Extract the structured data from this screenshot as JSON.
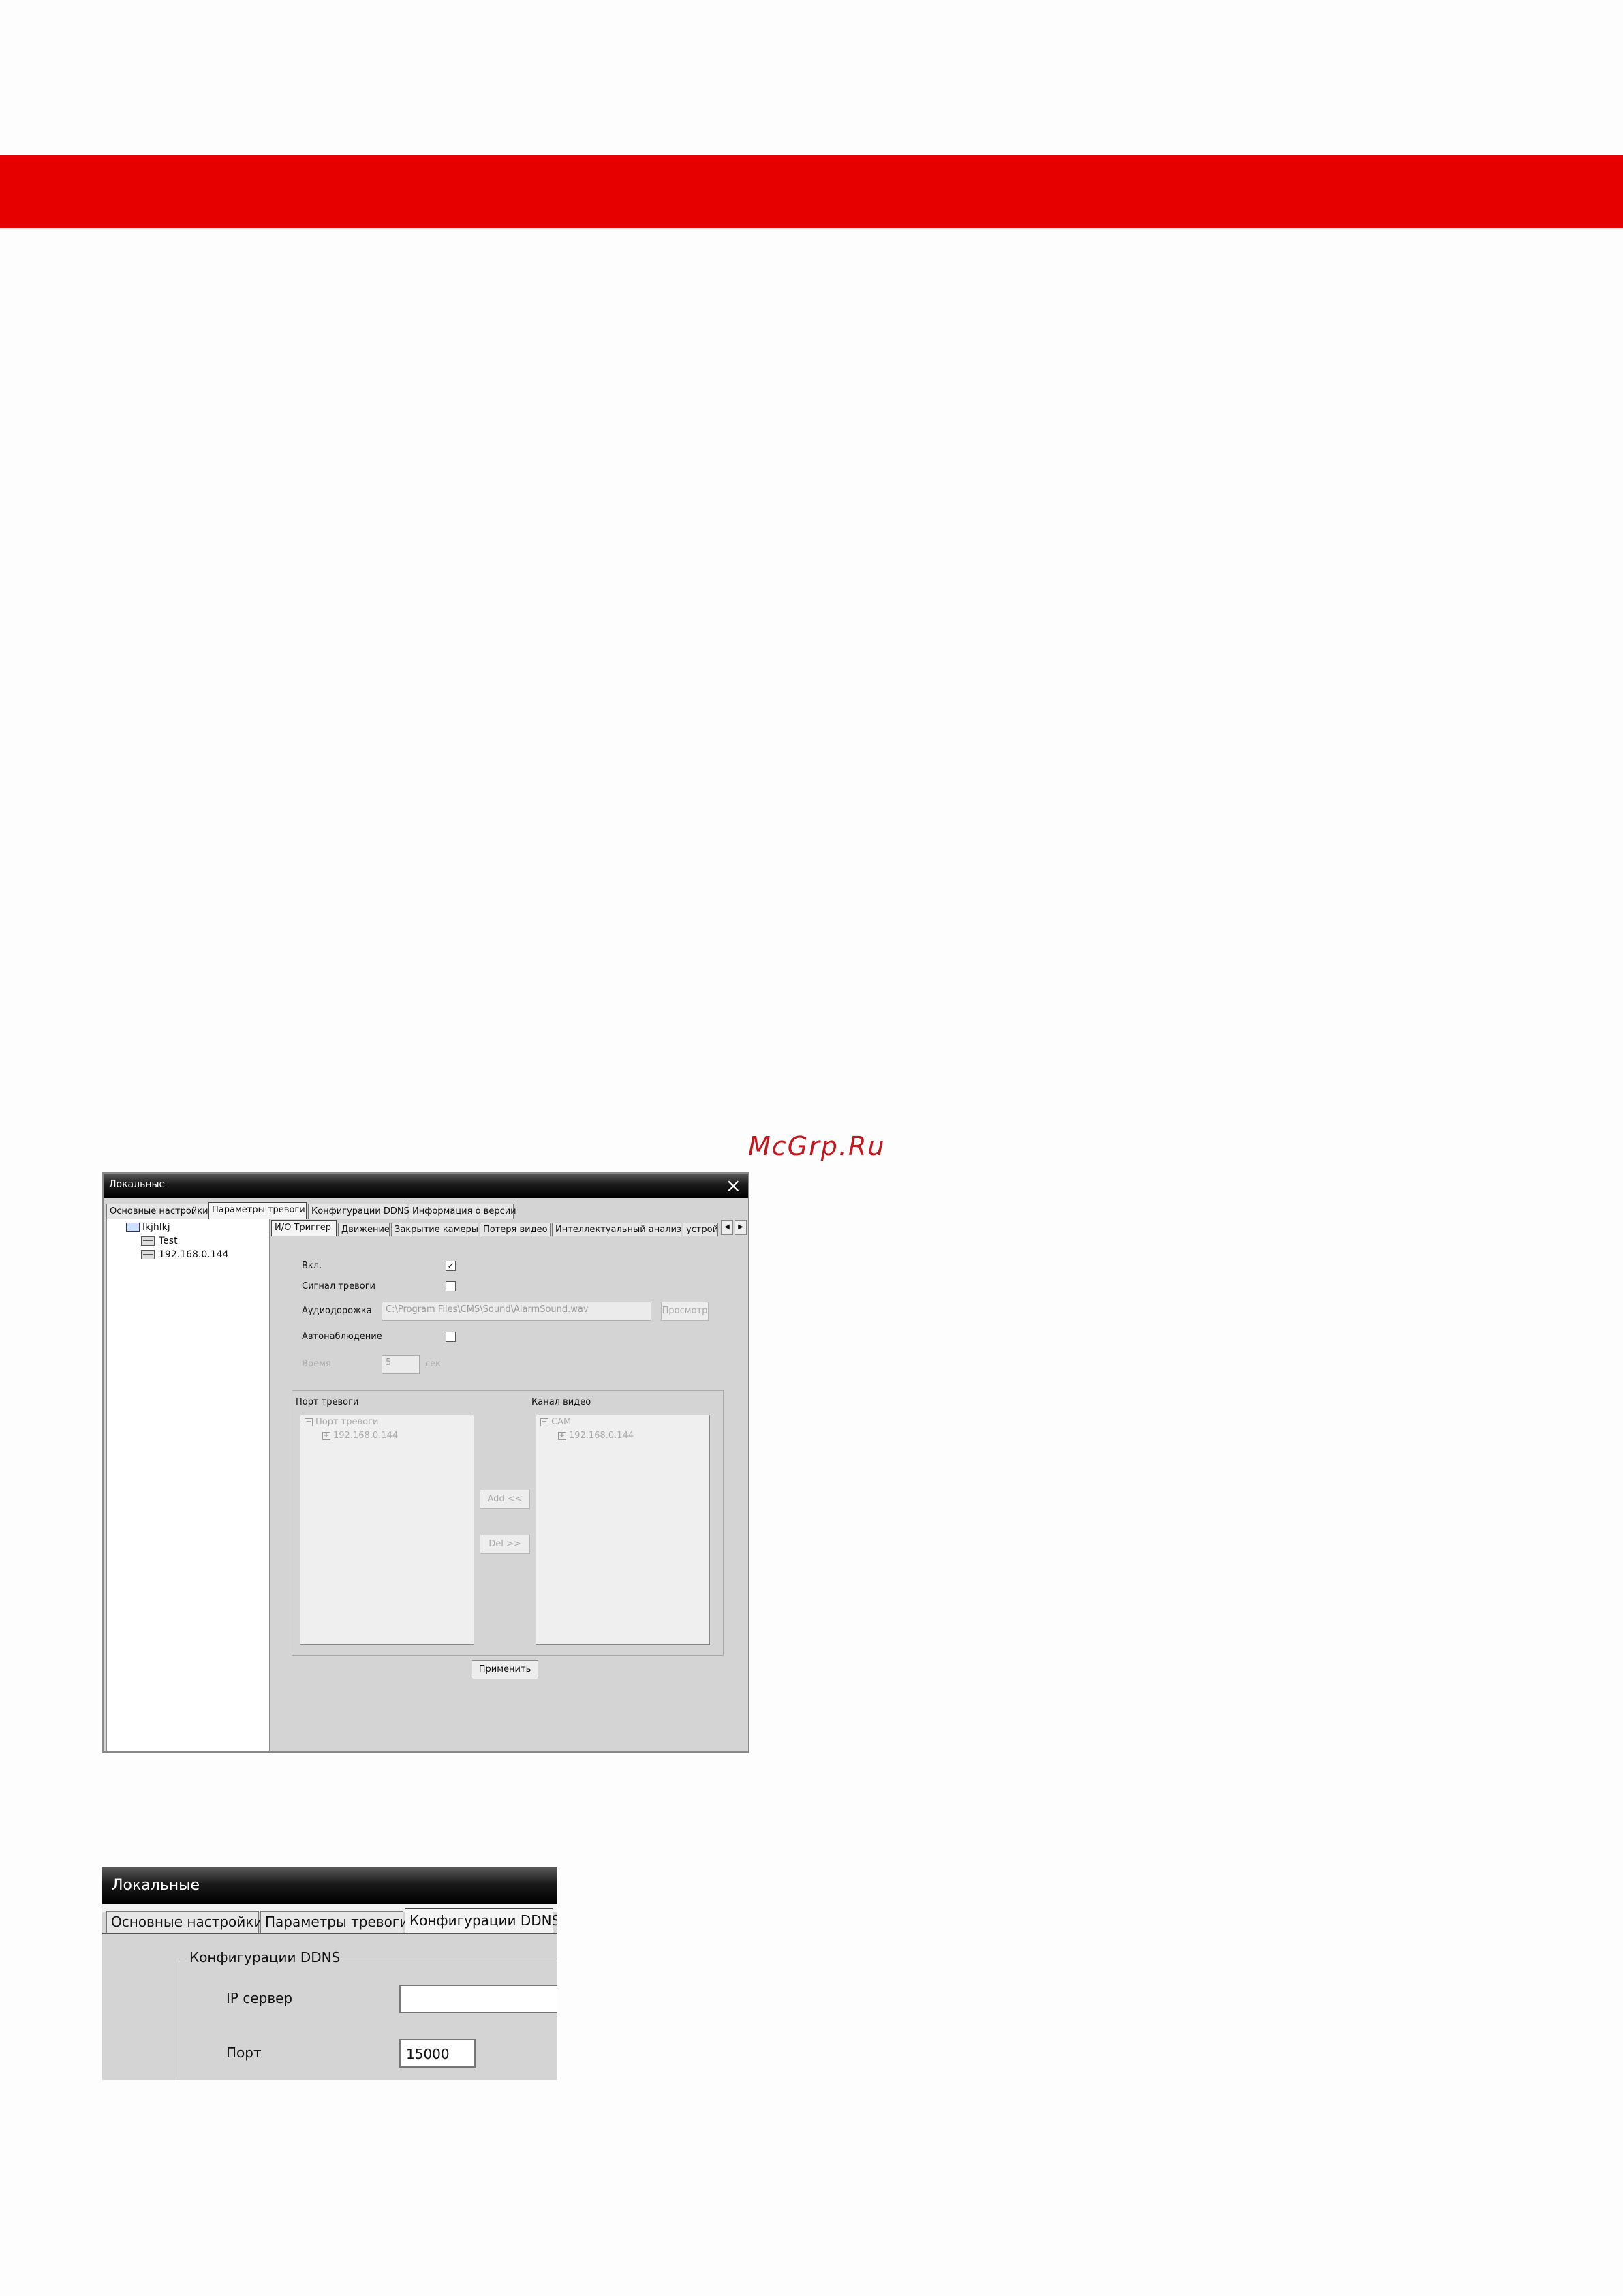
{
  "colors": {
    "banner": "#e60000",
    "watermark": "#c4161c"
  },
  "watermark": "McGrp.Ru",
  "window1": {
    "title": "Локальные",
    "main_tabs": [
      "Основные настройки",
      "Параметры тревоги",
      "Конфигурации DDNS",
      "Информация о версии"
    ],
    "tree": {
      "root": "lkjhlkj",
      "children": [
        "Test",
        "192.168.0.144"
      ]
    },
    "sub_tabs": [
      "И/О Триггер",
      "Движение",
      "Закрытие камеры",
      "Потеря видео",
      "Интеллектуальный анализ",
      "устрой"
    ],
    "enable_label": "Вкл.",
    "alarm_signal_label": "Сигнал тревоги",
    "audio_label": "Аудиодорожка",
    "audio_path": "C:\\Program Files\\CMS\\Sound\\AlarmSound.wav",
    "browse_label": "Просмотр",
    "auto_monitor_label": "Автонаблюдение",
    "time_label": "Время",
    "time_value": "5",
    "time_unit": "сек",
    "alarm_port_title": "Порт тревоги",
    "alarm_port_tree": {
      "root": "Порт тревоги",
      "child": "192.168.0.144"
    },
    "video_channel_title": "Канал видео",
    "video_channel_tree": {
      "root": "CAM",
      "child": "192.168.0.144"
    },
    "add_label": "Add <<",
    "del_label": "Del >>",
    "apply_label": "Применить",
    "enable_checked": true,
    "alarm_signal_checked": false,
    "auto_monitor_checked": false
  },
  "window2": {
    "title": "Локальные",
    "tabs": [
      "Основные настройки",
      "Параметры тревоги",
      "Конфигурации DDNS"
    ],
    "group_title": "Конфигурации DDNS",
    "ip_label": "IP сервер",
    "ip_value": "",
    "port_label": "Порт",
    "port_value": "15000"
  }
}
